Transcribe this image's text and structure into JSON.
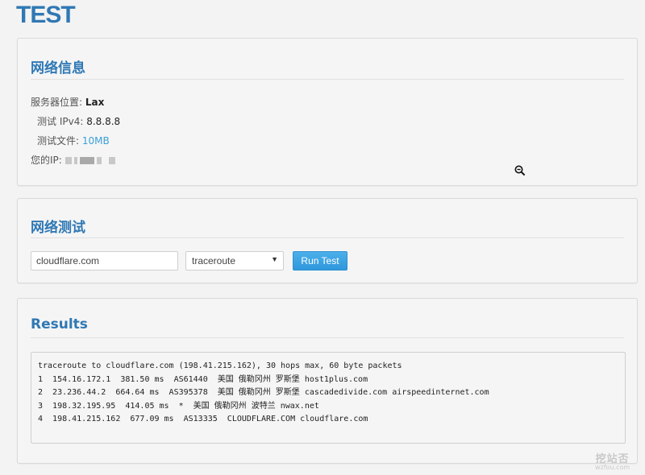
{
  "page_title": "TEST",
  "info": {
    "heading": "网络信息",
    "server_location_label": "服务器位置:",
    "server_location_value": "Lax",
    "ipv4_label": "测试 IPv4:",
    "ipv4_value": "8.8.8.8",
    "file_label": "测试文件:",
    "file_value": "10MB",
    "your_ip_label": "您的IP:"
  },
  "test": {
    "heading": "网络测试",
    "host_value": "cloudflare.com",
    "method_selected": "traceroute",
    "run_label": "Run Test"
  },
  "results": {
    "heading": "Results",
    "lines": [
      "traceroute to cloudflare.com (198.41.215.162), 30 hops max, 60 byte packets",
      "1  154.16.172.1  381.50 ms  AS61440  美国 俄勒冈州 罗斯堡 host1plus.com",
      "2  23.236.44.2  664.64 ms  AS395378  美国 俄勒冈州 罗斯堡 cascadedivide.com airspeedinternet.com",
      "3  198.32.195.95  414.05 ms  *  美国 俄勒冈州 波特兰 nwax.net",
      "4  198.41.215.162  677.09 ms  AS13335  CLOUDFLARE.COM cloudflare.com"
    ]
  },
  "watermark": {
    "main": "挖站否",
    "sub": "wzfou.com"
  },
  "colors": {
    "accent": "#2f78b4",
    "link": "#3aa0d8",
    "button": "#2f97dc"
  }
}
